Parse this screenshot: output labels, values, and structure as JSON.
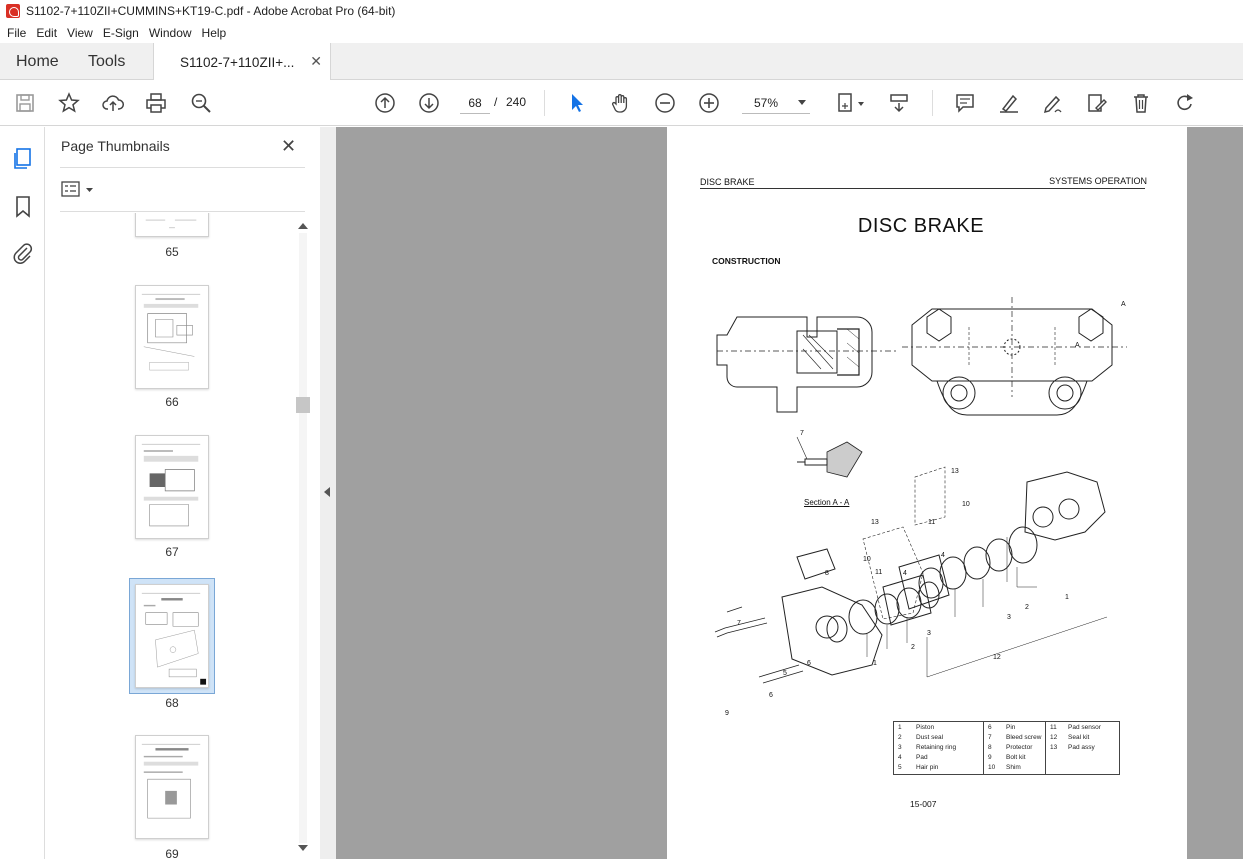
{
  "window": {
    "title": "S1102-7+110ZII+CUMMINS+KT19-C.pdf - Adobe Acrobat Pro (64-bit)"
  },
  "menu": [
    "File",
    "Edit",
    "View",
    "E-Sign",
    "Window",
    "Help"
  ],
  "tabs": {
    "home": "Home",
    "tools": "Tools",
    "document": "S1102-7+110ZII+..."
  },
  "toolbar": {
    "current_page": "68",
    "page_separator": "/",
    "total_pages": "240",
    "zoom": "57%"
  },
  "thumbnail_panel": {
    "title": "Page Thumbnails",
    "pages": [
      {
        "label": "65"
      },
      {
        "label": "66"
      },
      {
        "label": "67"
      },
      {
        "label": "68",
        "selected": true
      },
      {
        "label": "69"
      }
    ]
  },
  "document_page": {
    "header_left": "DISC BRAKE",
    "header_right": "SYSTEMS OPERATION",
    "title": "DISC BRAKE",
    "subtitle": "CONSTRUCTION",
    "section_label": "Section A - A",
    "figure_number": "15-007",
    "legend": [
      {
        "num": "1",
        "name": "Piston"
      },
      {
        "num": "2",
        "name": "Dust seal"
      },
      {
        "num": "3",
        "name": "Retaining ring"
      },
      {
        "num": "4",
        "name": "Pad"
      },
      {
        "num": "5",
        "name": "Hair pin"
      },
      {
        "num": "6",
        "name": "Pin"
      },
      {
        "num": "7",
        "name": "Bleed screw"
      },
      {
        "num": "8",
        "name": "Protector"
      },
      {
        "num": "9",
        "name": "Bolt kit"
      },
      {
        "num": "10",
        "name": "Shim"
      },
      {
        "num": "11",
        "name": "Pad sensor"
      },
      {
        "num": "12",
        "name": "Seal kit"
      },
      {
        "num": "13",
        "name": "Pad assy"
      }
    ],
    "callouts": [
      "A",
      "A",
      "7",
      "13",
      "13",
      "11",
      "10",
      "4",
      "4",
      "10",
      "11",
      "8",
      "7",
      "6",
      "5",
      "6",
      "9",
      "1",
      "2",
      "3",
      "1",
      "2",
      "3",
      "12"
    ]
  }
}
